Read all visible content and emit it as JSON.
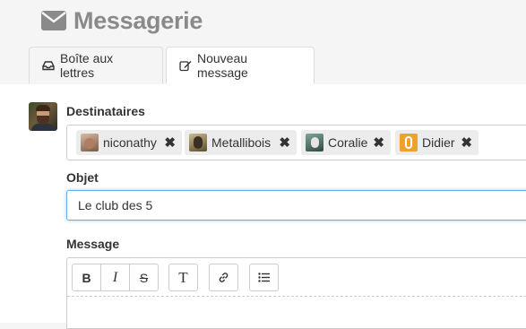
{
  "header": {
    "title": "Messagerie",
    "icon": "envelope-icon"
  },
  "tabs": [
    {
      "label": "Boîte aux lettres",
      "icon": "inbox-icon",
      "active": false
    },
    {
      "label": "Nouveau message",
      "icon": "edit-icon",
      "active": true
    }
  ],
  "form": {
    "recipients_label": "Destinataires",
    "recipients": [
      {
        "name": "niconathy"
      },
      {
        "name": "Metallibois"
      },
      {
        "name": "Coralie"
      },
      {
        "name": "Didier"
      }
    ],
    "remove_glyph": "✖",
    "subject_label": "Objet",
    "subject_value": "Le club des 5",
    "message_label": "Message"
  },
  "toolbar": {
    "bold": "B",
    "italic": "I",
    "strike": "S",
    "text_style": "T"
  },
  "colors": {
    "focus_border": "#66afe9",
    "chip_bg": "#ececec",
    "header_text": "#8a8a8a"
  }
}
